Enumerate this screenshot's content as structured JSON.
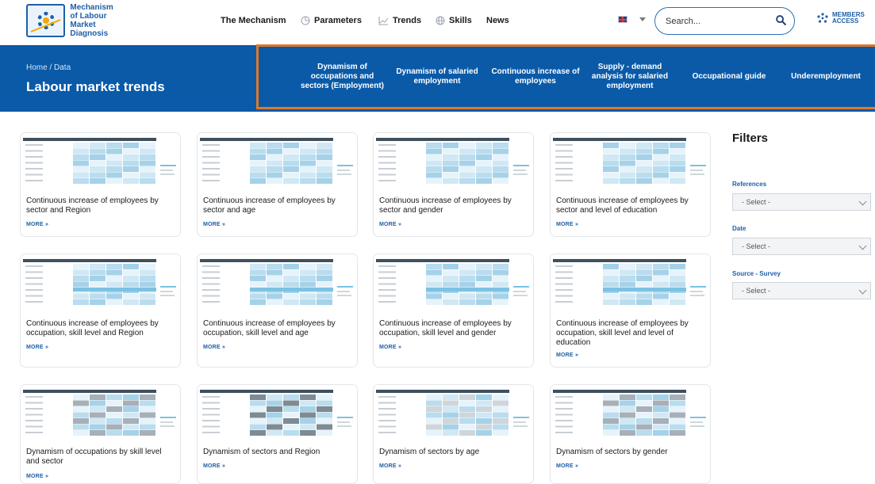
{
  "logo": {
    "line1": "Mechanism",
    "line2": "of Labour",
    "line3": "Market Diagnosis"
  },
  "nav": {
    "items": [
      {
        "label": "The Mechanism",
        "icon": ""
      },
      {
        "label": "Parameters",
        "icon": "pie-chart-icon"
      },
      {
        "label": "Trends",
        "icon": "line-chart-icon"
      },
      {
        "label": "Skills",
        "icon": "globe-icon"
      },
      {
        "label": "News",
        "icon": ""
      }
    ]
  },
  "language": {
    "icon": "uk-flag-icon"
  },
  "search": {
    "placeholder": "Search..."
  },
  "members": {
    "line1": "MEMBERS",
    "line2": "ACCESS"
  },
  "banner": {
    "breadcrumb": "Home / Data",
    "title": "Labour market trends",
    "subnav": [
      "Dynamism of occupations and sectors (Employment)",
      "Dynamism of salaried employment",
      "Continuous increase of employees",
      "Supply - demand analysis for salaried employment",
      "Occupational guide",
      "Underemployment"
    ]
  },
  "cards": [
    {
      "title": "Continuous increase of employees by sector and Region",
      "more": "MORE »"
    },
    {
      "title": "Continuous increase of employees by sector and age",
      "more": "MORE »"
    },
    {
      "title": "Continuous increase of employees by sector and gender",
      "more": "MORE »"
    },
    {
      "title": "Continuous increase of employees by sector and level of education",
      "more": "MORE »"
    },
    {
      "title": "Continuous increase of employees by occupation, skill level and Region",
      "more": "MORE »"
    },
    {
      "title": "Continuous increase of employees by occupation, skill level and age",
      "more": "MORE »"
    },
    {
      "title": "Continuous increase of employees by occupation, skill level and gender",
      "more": "MORE »"
    },
    {
      "title": "Continuous increase of employees by occupation, skill level and level of education",
      "more": "MORE »"
    },
    {
      "title": "Dynamism of occupations by skill level and sector",
      "more": "MORE »"
    },
    {
      "title": "Dynamism of sectors and Region",
      "more": "MORE »"
    },
    {
      "title": "Dynamism of sectors by age",
      "more": "MORE »"
    },
    {
      "title": "Dynamism of sectors by gender",
      "more": "MORE »"
    }
  ],
  "filters": {
    "title": "Filters",
    "groups": [
      {
        "label": "References",
        "value": "- Select -"
      },
      {
        "label": "Date",
        "value": "- Select -"
      },
      {
        "label": "Source - Survey",
        "value": "- Select -"
      }
    ]
  },
  "colors": {
    "brand_blue": "#0a5aa8",
    "accent_orange": "#e0782a",
    "link_blue": "#1f5fa6"
  }
}
